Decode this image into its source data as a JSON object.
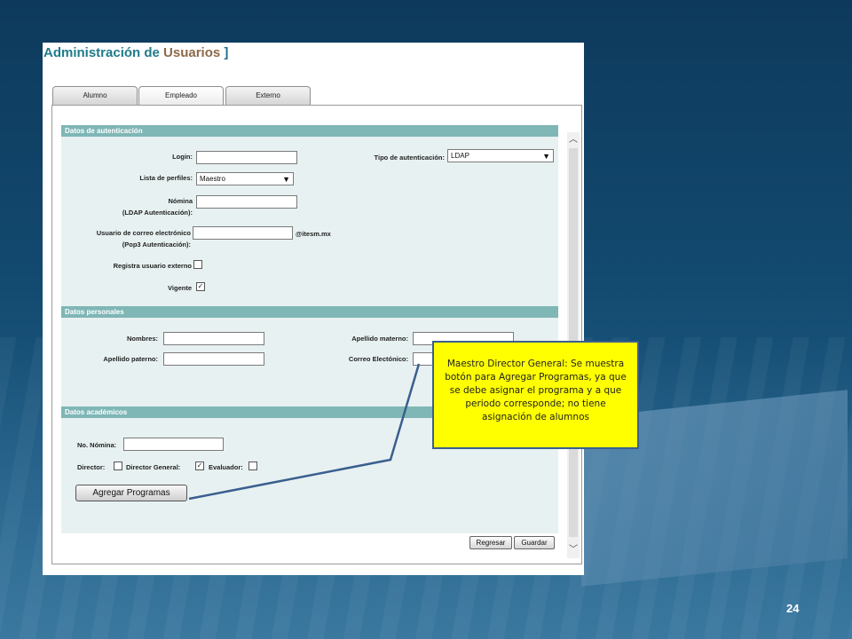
{
  "app": {
    "title_main": "Administración de ",
    "title_accent": "Usuarios",
    "title_bracket": " ]"
  },
  "tabs": [
    {
      "label": "Alumno",
      "active": false
    },
    {
      "label": "Empleado",
      "active": true
    },
    {
      "label": "Externo",
      "active": false
    }
  ],
  "auth": {
    "header": "Datos de autenticación",
    "login_label": "Login:",
    "login_value": "",
    "auth_type_label": "Tipo de autenticación:",
    "auth_type_selected": "LDAP",
    "profiles_label": "Lista de perfiles:",
    "profiles_selected": "Maestro",
    "nomina_label_1": "Nómina",
    "nomina_label_2": "(LDAP Autenticación):",
    "nomina_value": "",
    "email_label_1": "Usuario de correo electrónico",
    "email_label_2": "(Pop3 Autenticación):",
    "email_value": "",
    "email_suffix": "@itesm.mx",
    "external_label": "Registra usuario externo",
    "external_checked": false,
    "vigente_label": "Vigente",
    "vigente_checked": true
  },
  "personal": {
    "header": "Datos personales",
    "nombres_label": "Nombres:",
    "nombres_value": "",
    "paterno_label": "Apellido paterno:",
    "paterno_value": "",
    "materno_label": "Apellido materno:",
    "materno_value": "",
    "correo_label": "Correo Electónico:",
    "correo_value": ""
  },
  "academic": {
    "header": "Datos académicos",
    "nomina_label": "No. Nómina:",
    "nomina_value": "",
    "director_label": "Director:",
    "director_checked": false,
    "director_general_label": "Director General:",
    "director_general_checked": true,
    "evaluador_label": "Evaluador:",
    "evaluador_checked": false,
    "add_programs_label": "Agregar Programas"
  },
  "actions": {
    "reset_label": "Regresar",
    "save_label": "Guardar"
  },
  "callout": {
    "text": "Maestro Director General: Se muestra botón para Agregar Programas,  ya que se debe asignar el programa y a que periodo corresponde; no tiene asignación de alumnos"
  },
  "slide": {
    "page_number": "24"
  },
  "colors": {
    "section_header": "#7fb6b6",
    "callout_bg": "#ffff00",
    "title": "#1f7b8a"
  }
}
